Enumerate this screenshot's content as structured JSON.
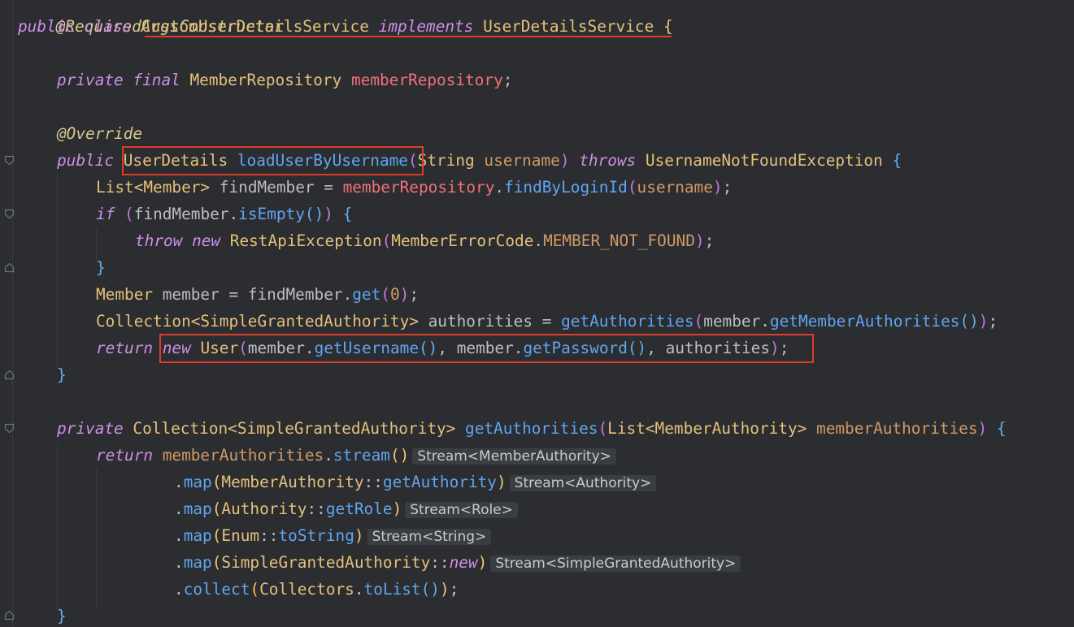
{
  "editor": {
    "top_annotation": "@RequiredArgsConstructor",
    "line_class_decl": {
      "k1": "public",
      "k2": "class",
      "name": "CustomUserDetailsService",
      "k3": "implements",
      "iface": "UserDetailsService",
      "brace": "{"
    },
    "line_field": {
      "k1": "private",
      "k2": "final",
      "type": "MemberRepository",
      "name": "memberRepository",
      "semi": ";"
    },
    "line_override": {
      "ann": "@Override"
    },
    "line_method_sig": {
      "k1": "public",
      "ret": "UserDetails",
      "name": "loadUserByUsername",
      "p_open": "(",
      "ptype": "String",
      "pname": "username",
      "p_close": ")",
      "k2": "throws",
      "exc": "UsernameNotFoundException",
      "brace": "{"
    },
    "line_find": {
      "t1": "List",
      "t2": "<Member>",
      "var": "findMember",
      "eq": " = ",
      "fld": "memberRepository",
      "dot": ".",
      "m": "findByLoginId",
      "o": "(",
      "arg": "username",
      "c": ")",
      "semi": ";"
    },
    "line_if": {
      "k": "if",
      "o": "(",
      "v": "findMember",
      "dot": ".",
      "m": "isEmpty",
      "oc": "()",
      "c": ")",
      "brace": "{"
    },
    "line_throw": {
      "k1": "throw",
      "k2": "new",
      "type": "RestApiException",
      "o": "(",
      "t2": "MemberErrorCode",
      "dot": ".",
      "cst": "MEMBER_NOT_FOUND",
      "c": ")",
      "semi": ";"
    },
    "line_if_close": {
      "brace": "}"
    },
    "line_member": {
      "type": "Member",
      "var": "member",
      "eq": " = ",
      "v": "findMember",
      "dot": ".",
      "m": "get",
      "o": "(",
      "num": "0",
      "c": ")",
      "semi": ";"
    },
    "line_coll": {
      "type": "Collection<SimpleGrantedAuthority>",
      "var": "authorities",
      "eq": " = ",
      "m": "getAuthorities",
      "o": "(",
      "v": "member",
      "dot": ".",
      "m2": "getMemberAuthorities",
      "oc": "()",
      "c": ")",
      "semi": ";"
    },
    "line_return": {
      "k1": "return",
      "k2": "new",
      "type": "User",
      "o": "(",
      "v1": "member",
      "dot1": ".",
      "m1": "getUsername",
      "oc1": "()",
      "comma1": ", ",
      "v2": "member",
      "dot2": ".",
      "m2": "getPassword",
      "oc2": "()",
      "comma2": ", ",
      "v3": "authorities",
      "c": ")",
      "semi": ";"
    },
    "line_method_close": {
      "brace": "}"
    },
    "line_get_auth_sig": {
      "k1": "private",
      "ret": "Collection<SimpleGrantedAuthority>",
      "name": "getAuthorities",
      "o": "(",
      "ptype": "List<MemberAuthority>",
      "pname": "memberAuthorities",
      "c": ")",
      "brace": "{"
    },
    "line_stream": {
      "k": "return",
      "v": "memberAuthorities",
      "dot": ".",
      "m": "stream",
      "oc": "()",
      "hint": "Stream<MemberAuthority>"
    },
    "line_map1": {
      "dot": ".",
      "m": "map",
      "o": "(",
      "t": "MemberAuthority",
      "sep": "::",
      "ref": "getAuthority",
      "c": ")",
      "hint": "Stream<Authority>"
    },
    "line_map2": {
      "dot": ".",
      "m": "map",
      "o": "(",
      "t": "Authority",
      "sep": "::",
      "ref": "getRole",
      "c": ")",
      "hint": "Stream<Role>"
    },
    "line_map3": {
      "dot": ".",
      "m": "map",
      "o": "(",
      "t": "Enum",
      "sep": "::",
      "ref": "toString",
      "c": ")",
      "hint": "Stream<String>"
    },
    "line_map4": {
      "dot": ".",
      "m": "map",
      "o": "(",
      "t": "SimpleGrantedAuthority",
      "sep": "::",
      "ref": "new",
      "c": ")",
      "hint": "Stream<SimpleGrantedAuthority>"
    },
    "line_collect": {
      "dot": ".",
      "m": "collect",
      "o": "(",
      "t": "Collectors",
      "dot2": ".",
      "m2": "toList",
      "oc": "()",
      "c": ")",
      "semi": ";"
    },
    "line_class_close": {
      "brace": "}"
    }
  },
  "colors": {
    "background": "#2b2d30",
    "keyword": "#cf8ee8",
    "type": "#e6c07b",
    "field": "#f07178",
    "method": "#60a5f0",
    "highlight_box": "#e03c2a"
  }
}
